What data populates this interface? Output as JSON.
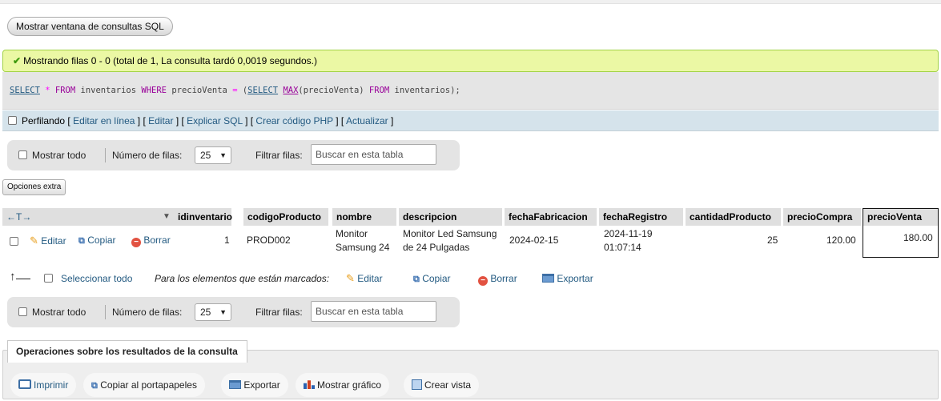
{
  "toolbar": {
    "sql_window_label": "Mostrar ventana de consultas SQL"
  },
  "message": {
    "success_text": "Mostrando filas 0 - 0 (total de 1, La consulta tardó 0,0019 segundos.)"
  },
  "query": {
    "select": "SELECT",
    "star": " * ",
    "from1": "FROM",
    "table1": " inventarios ",
    "where": "WHERE",
    "column1": " precioVenta ",
    "eq": "=",
    "paren_open": " (",
    "select2": "SELECT",
    "sp": " ",
    "max": "MAX",
    "column2": "(precioVenta) ",
    "from2": "FROM",
    "table2": " inventarios);"
  },
  "profiling": {
    "label": "Perfilando",
    "links": [
      "Editar en línea",
      "Editar",
      "Explicar SQL",
      "Crear código PHP",
      "Actualizar"
    ]
  },
  "nav": {
    "show_all": "Mostrar todo",
    "rows_label": "Número de filas:",
    "rows_value": "25",
    "filter_label": "Filtrar filas:",
    "filter_placeholder": "Buscar en esta tabla"
  },
  "extra_options": "Opciones extra",
  "table": {
    "arrows": "←T→",
    "sort_icon": "▼",
    "columns": [
      "idinventario",
      "codigoProducto",
      "nombre",
      "descripcion",
      "fechaFabricacion",
      "fechaRegistro",
      "cantidadProducto",
      "precioCompra",
      "precioVenta"
    ],
    "row_actions": {
      "edit": "Editar",
      "copy": "Copiar",
      "delete": "Borrar"
    },
    "row": {
      "idinventario": "1",
      "codigoProducto": "PROD002",
      "nombre_l1": "Monitor",
      "nombre_l2": "Samsung 24",
      "descripcion_l1": "Monitor Led Samsung",
      "descripcion_l2": "de 24 Pulgadas",
      "fechaFabricacion": "2024-02-15",
      "fechaRegistro_l1": "2024-11-19",
      "fechaRegistro_l2": "01:07:14",
      "cantidadProducto": "25",
      "precioCompra": "120.00",
      "precioVenta": "180.00"
    }
  },
  "mass_actions": {
    "select_all": "Seleccionar todo",
    "with_selected": "Para los elementos que están marcados:",
    "edit": "Editar",
    "copy": "Copiar",
    "delete": "Borrar",
    "export": "Exportar"
  },
  "operations": {
    "title": "Operaciones sobre los resultados de la consulta",
    "print": "Imprimir",
    "copy_clipboard": "Copiar al portapapeles",
    "export": "Exportar",
    "chart": "Mostrar gráfico",
    "create_view": "Crear vista"
  },
  "colors": {
    "success_bg": "#ebf8a4",
    "link": "#235a81",
    "profile_bg": "#d5e3eb",
    "keyword": "#990099"
  }
}
